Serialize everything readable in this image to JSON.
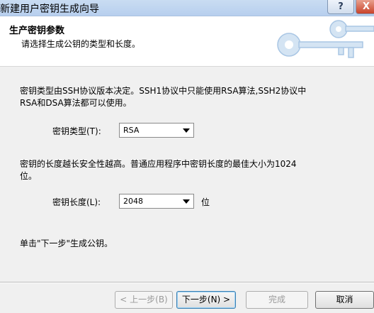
{
  "window": {
    "title": "新建用户密钥生成向导",
    "help_label": "?",
    "close_label": "X"
  },
  "header": {
    "title": "生产密钥参数",
    "subtitle": "请选择生成公钥的类型和长度。"
  },
  "content": {
    "intro_line1": "密钥类型由SSH协议版本决定。SSH1协议中只能使用RSA算法,SSH2协议中",
    "intro_line2": "RSA和DSA算法都可以使用。",
    "key_type_label": "密钥类型(T):",
    "key_type_value": "RSA",
    "length_line1": "密钥的长度越长安全性越高。普通应用程序中密钥长度的最佳大小为1024",
    "length_line2": "位。",
    "key_length_label": "密钥长度(L):",
    "key_length_value": "2048",
    "key_length_unit": "位",
    "instruction": "单击\"下一步\"生成公钥。"
  },
  "buttons": {
    "back": "< 上一步(B)",
    "next": "下一步(N) >",
    "finish": "完成",
    "cancel": "取消"
  }
}
